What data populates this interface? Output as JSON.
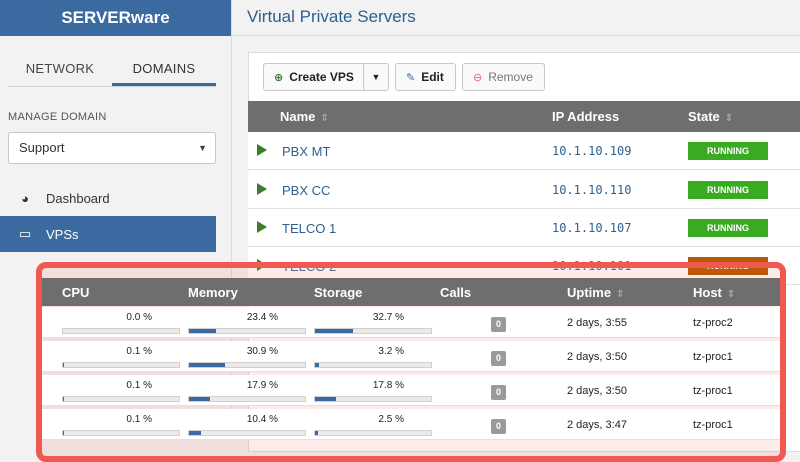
{
  "brand": "SERVERware",
  "sidebar": {
    "tabs": [
      "NETWORK",
      "DOMAINS"
    ],
    "manage_label": "MANAGE DOMAIN",
    "domain_value": "Support",
    "nav": [
      {
        "label": "Dashboard",
        "icon": "dashboard-icon"
      },
      {
        "label": "VPSs",
        "icon": "laptop-icon"
      }
    ]
  },
  "header": {
    "title": "Virtual Private Servers"
  },
  "toolbar": {
    "create_label": "Create VPS",
    "edit_label": "Edit",
    "remove_label": "Remove"
  },
  "vps_table": {
    "columns": [
      "Name",
      "IP Address",
      "State"
    ],
    "rows": [
      {
        "name": "PBX MT",
        "ip": "10.1.10.109",
        "state": "RUNNING"
      },
      {
        "name": "PBX CC",
        "ip": "10.1.10.110",
        "state": "RUNNING"
      },
      {
        "name": "TELCO 1",
        "ip": "10.1.10.107",
        "state": "RUNNING"
      },
      {
        "name": "TELCO 2",
        "ip": "10.1.10.101",
        "state": "RUNNING"
      }
    ]
  },
  "stats_table": {
    "columns": [
      "CPU",
      "Memory",
      "Storage",
      "Calls",
      "Uptime",
      "Host"
    ],
    "rows": [
      {
        "cpu": "0.0 %",
        "cpu_frac": 0.0,
        "memory": "23.4 %",
        "memory_frac": 0.234,
        "storage": "32.7 %",
        "storage_frac": 0.327,
        "calls": "0",
        "uptime": "2 days, 3:55",
        "host": "tz-proc2"
      },
      {
        "cpu": "0.1 %",
        "cpu_frac": 0.001,
        "memory": "30.9 %",
        "memory_frac": 0.309,
        "storage": "3.2 %",
        "storage_frac": 0.032,
        "calls": "0",
        "uptime": "2 days, 3:50",
        "host": "tz-proc1"
      },
      {
        "cpu": "0.1 %",
        "cpu_frac": 0.001,
        "memory": "17.9 %",
        "memory_frac": 0.179,
        "storage": "17.8 %",
        "storage_frac": 0.178,
        "calls": "0",
        "uptime": "2 days, 3:50",
        "host": "tz-proc1"
      },
      {
        "cpu": "0.1 %",
        "cpu_frac": 0.001,
        "memory": "10.4 %",
        "memory_frac": 0.104,
        "storage": "2.5 %",
        "storage_frac": 0.025,
        "calls": "0",
        "uptime": "2 days, 3:47",
        "host": "tz-proc1"
      }
    ]
  },
  "colors": {
    "brand": "#3b6aa0",
    "running": "#3aaa22",
    "highlight": "#f0594f"
  }
}
